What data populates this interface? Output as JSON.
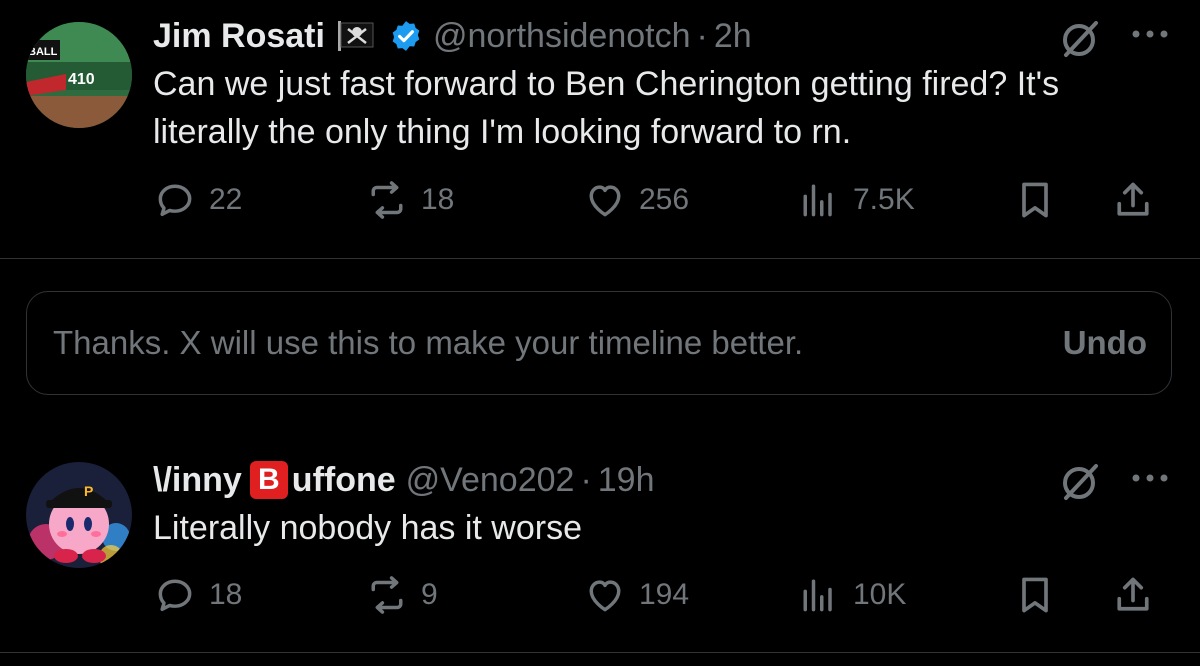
{
  "tweets": [
    {
      "display_name": "Jim Rosati",
      "badge_icon": "pirate-flag-icon",
      "verified": true,
      "handle": "@northsidenotch",
      "separator": "·",
      "time": "2h",
      "text": "Can we just fast forward to Ben Cherington getting fired? It's literally the only thing I'm looking forward to rn.",
      "avatar": {
        "scoreboard_text": "BALL",
        "sign_text": "410"
      },
      "replies": "22",
      "reposts": "18",
      "likes": "256",
      "views": "7.5K"
    },
    {
      "display_name_prefix": "\\/inny",
      "name_emoji": "B",
      "display_name_suffix": "uffone",
      "handle": "@Veno202",
      "separator": "·",
      "time": "19h",
      "text": "Literally nobody has it worse",
      "avatar": {
        "cap_letter": "P"
      },
      "replies": "18",
      "reposts": "9",
      "likes": "194",
      "views": "10K"
    }
  ],
  "feedback": {
    "message": "Thanks. X will use this to make your timeline better.",
    "undo_label": "Undo"
  },
  "colors": {
    "background": "#000000",
    "primary_text": "#e7e9ea",
    "secondary_text": "#71767b",
    "border": "#2f3336",
    "verified_blue": "#1d9bf0",
    "emoji_red": "#e02020"
  }
}
